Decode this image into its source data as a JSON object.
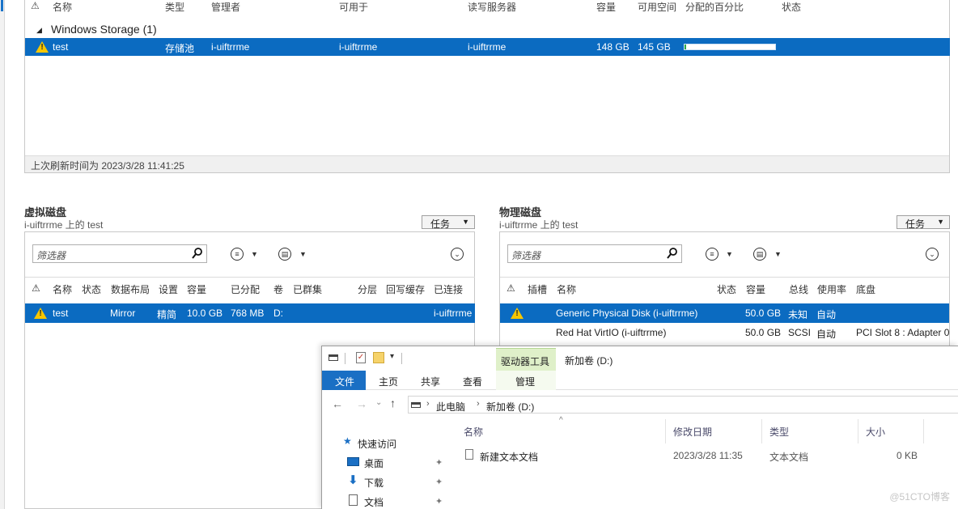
{
  "pools": {
    "columns": [
      "名称",
      "类型",
      "管理者",
      "可用于",
      "读写服务器",
      "容量",
      "可用空间",
      "分配的百分比",
      "状态"
    ],
    "group_label": "Windows Storage (1)",
    "row": {
      "name": "test",
      "type": "存储池",
      "managed_by": "i-uiftrrme",
      "available_to": "i-uiftrrme",
      "rw_server": "i-uiftrrme",
      "capacity": "148 GB",
      "free_space": "145 GB",
      "allocated_fraction": 0.02
    },
    "refresh_text": "上次刷新时间为 2023/3/28 11:41:25"
  },
  "virtual_disks": {
    "title": "虚拟磁盘",
    "subtitle": "i-uiftrrme 上的 test",
    "task_label": "任务",
    "filter_placeholder": "筛选器",
    "columns": [
      "名称",
      "状态",
      "数据布局",
      "设置",
      "容量",
      "已分配",
      "卷",
      "已群集",
      "分层",
      "回写缓存",
      "已连接"
    ],
    "row": {
      "name": "test",
      "layout": "Mirror",
      "provisioning": "精简",
      "capacity": "10.0 GB",
      "allocated": "768 MB",
      "volume": "D:",
      "attached": "i-uiftrrme"
    }
  },
  "physical_disks": {
    "title": "物理磁盘",
    "subtitle": "i-uiftrrme 上的 test",
    "task_label": "任务",
    "filter_placeholder": "筛选器",
    "columns": [
      "插槽",
      "名称",
      "状态",
      "容量",
      "总线",
      "使用率",
      "底盘"
    ],
    "rows": [
      {
        "name": "Generic Physical Disk (i-uiftrrme)",
        "capacity": "50.0 GB",
        "bus": "未知",
        "usage": "自动",
        "chassis": ""
      },
      {
        "name": "Red Hat VirtIO (i-uiftrrme)",
        "capacity": "50.0 GB",
        "bus": "SCSI",
        "usage": "自动",
        "chassis": "PCI Slot 8 : Adapter 0"
      }
    ]
  },
  "explorer": {
    "context_tab": "驱动器工具",
    "window_title": "新加卷 (D:)",
    "tabs": {
      "file": "文件",
      "home": "主页",
      "share": "共享",
      "view": "查看",
      "manage": "管理"
    },
    "breadcrumb": [
      "此电脑",
      "新加卷 (D:)"
    ],
    "nav": {
      "quick_access": "快速访问",
      "desktop": "桌面",
      "downloads": "下载",
      "documents": "文档"
    },
    "columns": {
      "name": "名称",
      "modified": "修改日期",
      "type": "类型",
      "size": "大小"
    },
    "file": {
      "name": "新建文本文档",
      "modified": "2023/3/28 11:35",
      "type": "文本文档",
      "size": "0 KB"
    }
  },
  "watermark": "@51CTO博客",
  "colors": {
    "selection": "#0b6bc1",
    "warning": "#f7c600",
    "file_tab": "#1a6fc4",
    "context_tab": "#dff0c9"
  }
}
